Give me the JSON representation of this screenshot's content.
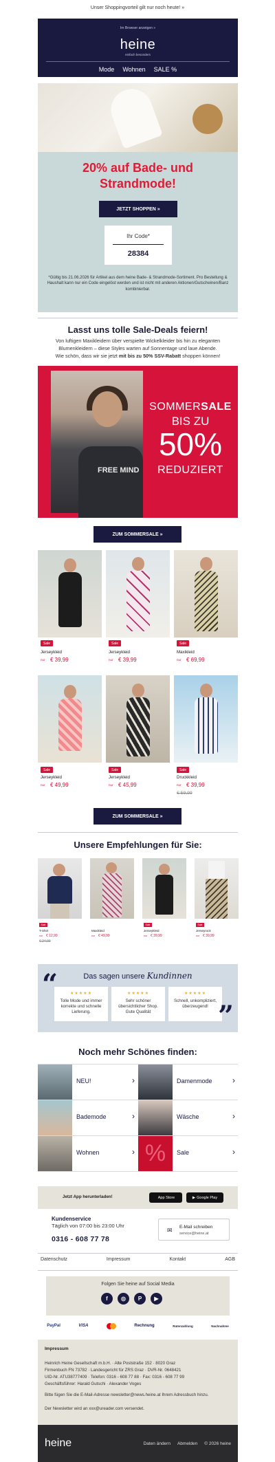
{
  "preheader": "Unser Shoppingvorteil gilt nur noch heute! »",
  "header": {
    "browser_link": "Im Browser anzeigen »",
    "logo": "heine",
    "tagline": "einfach besonders",
    "nav": [
      "Mode",
      "Wohnen",
      "SALE %"
    ]
  },
  "hero": {
    "headline_line1": "20% auf Bade- und",
    "headline_line2": "Strandmode!",
    "cta": "JETZT SHOPPEN »",
    "code_label": "Ihr Code*",
    "code_value": "28384",
    "fineprint": "*Gültig bis 21.06.2026 für Artikel aus dem heine Bade- & Strandmode-Sortiment. Pro Bestellung & Haushalt kann nur ein Code eingelöst werden und ist nicht mit anderen Aktionen/Gutscheinen/Banz kombinierbar."
  },
  "intro": {
    "heading": "Lasst uns tolle Sale-Deals feiern!",
    "text_line1": "Von luftigen Maxikleidern über verspielte Wickelkleider bis hin zu eleganten",
    "text_line2": "Blumenkleidern – diese Styles warten auf Sonnentage und laue Abende.",
    "text_line3_pre": "Wie schön, dass wir sie jetzt ",
    "text_line3_bold": "mit bis zu 50% SSV-Rabatt",
    "text_line3_post": " shoppen können!"
  },
  "banner": {
    "line1_light": "SOMMER",
    "line1_bold": "SALE",
    "line2": "BIS ZU",
    "line3": "50%",
    "line4": "REDUZIERT",
    "shirt_text": "FREE MIND"
  },
  "sale_cta": "ZUM SOMMERSALE »",
  "products": [
    {
      "badge": "Sale",
      "name": "Jerseykleid",
      "ab": "nur",
      "price": "€ 39,99",
      "old": ""
    },
    {
      "badge": "Sale",
      "name": "Jerseykleid",
      "ab": "nur",
      "price": "€ 39,99",
      "old": ""
    },
    {
      "badge": "Sale",
      "name": "Maxikleid",
      "ab": "nur",
      "price": "€ 69,99",
      "old": ""
    },
    {
      "badge": "Sale",
      "name": "Jerseykleid",
      "ab": "nur",
      "price": "€ 49,99",
      "old": ""
    },
    {
      "badge": "Sale",
      "name": "Jerseykleid",
      "ab": "nur",
      "price": "€ 45,99",
      "old": ""
    },
    {
      "badge": "Sale",
      "name": "Druckkleid",
      "ab": "nur",
      "price": "€ 39,99",
      "old": "€ 59,99"
    }
  ],
  "recommendations": {
    "heading": "Unsere Empfehlungen für Sie:",
    "items": [
      {
        "badge": "Sale",
        "name": "T-Shirt",
        "ab": "nur",
        "price": "€ 12,99",
        "old": "€ 24,99"
      },
      {
        "badge": "",
        "name": "Maxikleid",
        "ab": "nur",
        "price": "€ 49,99",
        "old": ""
      },
      {
        "badge": "Sale",
        "name": "Jerseykleid",
        "ab": "nur",
        "price": "€ 39,99",
        "old": ""
      },
      {
        "badge": "Sale",
        "name": "Jerseyrock",
        "ab": "nur",
        "price": "€ 39,99",
        "old": ""
      }
    ]
  },
  "reviews": {
    "title_pre": "Das sagen unsere ",
    "title_script": "Kundinnen",
    "stars": "★★★★★",
    "items": [
      {
        "text": "Tolle Mode und immer korrekte und schnelle Lieferung."
      },
      {
        "text": "Sehr schöner übersichtlicher Shop. Gute Qualität"
      },
      {
        "text": "Schnell, unkompliziert, überzeugend!"
      }
    ]
  },
  "categories": {
    "heading": "Noch mehr Schönes finden:",
    "items": [
      {
        "label": "NEU!"
      },
      {
        "label": "Damenmode"
      },
      {
        "label": "Bademode"
      },
      {
        "label": "Wäsche"
      },
      {
        "label": "Wohnen"
      },
      {
        "label": "Sale"
      }
    ]
  },
  "app": {
    "text": "Jetzt App herunterladen!",
    "appstore": "App Store",
    "googleplay": "Google Play"
  },
  "service": {
    "heading": "Kundenservice",
    "hours": "Täglich von 07:00 bis 23:00 Uhr",
    "phone": "0316 - 608 77 78",
    "mail_label": "E-Mail schreiben",
    "mail_address": "service@heine.at"
  },
  "footer_links": [
    "Datenschutz",
    "Impressum",
    "Kontakt",
    "AGB"
  ],
  "social": {
    "heading": "Folgen Sie heine auf Social Media"
  },
  "payments": [
    "PayPal",
    "VISA",
    "Mastercard",
    "Rechnung",
    "Ratenzahlung",
    "Nachnahme"
  ],
  "impressum": {
    "heading": "Impressum",
    "line1": "Heinrich Heine Gesellschaft m.b.H. · Alte Poststraße 152 · 8020 Graz",
    "line2": "Firmenbuch FN 73782 · Landesgericht für ZRS Graz · DVR-Nr. 0648421",
    "line3": "UID-Nr. ATU38777409 · Telefon: 0316 - 608 77 88 · Fax: 0316 - 608 77 99",
    "line4": "Geschäftsführer: Harald Gutschi · Alexander Voges",
    "line5": "Bitte fügen Sie die E-Mail-Adresse newsletter@news.heine.at Ihrem Adressbuch hinzu.",
    "line6": "Der Newsletter wird an xxx@ureader.com versendet."
  },
  "footer": {
    "logo": "heine",
    "links": [
      "Daten ändern",
      "Abmelden",
      "© 2026 heine"
    ]
  }
}
